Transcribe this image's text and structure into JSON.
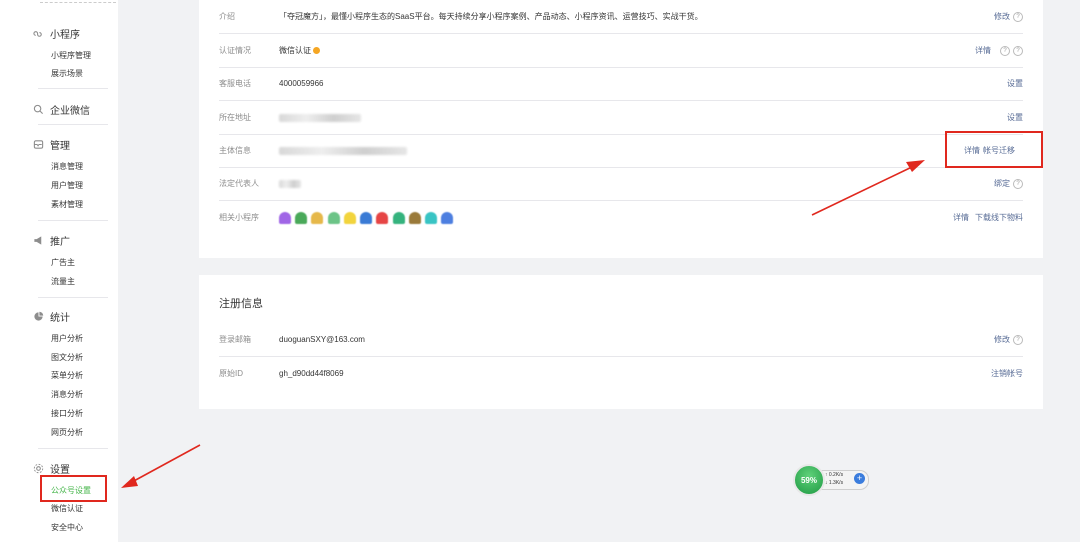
{
  "sidebar": {
    "sections": [
      {
        "icon": "mini-program-icon",
        "label": "小程序",
        "items": [
          "小程序管理",
          "展示场景"
        ]
      },
      {
        "icon": "search-icon",
        "label": "企业微信",
        "items": []
      },
      {
        "icon": "inbox-icon",
        "label": "管理",
        "items": [
          "消息管理",
          "用户管理",
          "素材管理"
        ]
      },
      {
        "icon": "megaphone-icon",
        "label": "推广",
        "items": [
          "广告主",
          "流量主"
        ]
      },
      {
        "icon": "pie-chart-icon",
        "label": "统计",
        "items": [
          "用户分析",
          "图文分析",
          "菜单分析",
          "消息分析",
          "接口分析",
          "网页分析"
        ]
      },
      {
        "icon": "gear-icon",
        "label": "设置",
        "items": [
          "公众号设置",
          "微信认证",
          "安全中心"
        ]
      }
    ],
    "active_item": "公众号设置"
  },
  "account": {
    "intro": {
      "label": "介绍",
      "value": "「夺冠魔方」，最懂小程序生态的SaaS平台。每天持续分享小程序案例、产品动态、小程序资讯、运营技巧、实战干货。",
      "action": "修改"
    },
    "verify": {
      "label": "认证情况",
      "value": "微信认证",
      "action": "详情"
    },
    "phone": {
      "label": "客服电话",
      "value": "4000059966",
      "action": "设置"
    },
    "address": {
      "label": "所在地址",
      "action": "设置"
    },
    "subject": {
      "label": "主体信息",
      "action1": "详情",
      "action2": "帐号迁移"
    },
    "legal": {
      "label": "法定代表人",
      "action": "绑定"
    },
    "mini": {
      "label": "相关小程序",
      "action1": "详情",
      "action2": "下载线下物料"
    }
  },
  "register": {
    "title": "注册信息",
    "email": {
      "label": "登录邮箱",
      "value": "duoguanSXY@163.com",
      "action": "修改"
    },
    "original_id": {
      "label": "原始ID",
      "value": "gh_d90dd44f8069",
      "action": "注销帐号"
    }
  },
  "speed_widget": {
    "percent": "59%",
    "up": "0.2K/s",
    "down": "1.3K/s"
  },
  "colors": {
    "accent_green": "#44b549",
    "link_blue": "#576b95",
    "annotation_red": "#e0281e"
  }
}
